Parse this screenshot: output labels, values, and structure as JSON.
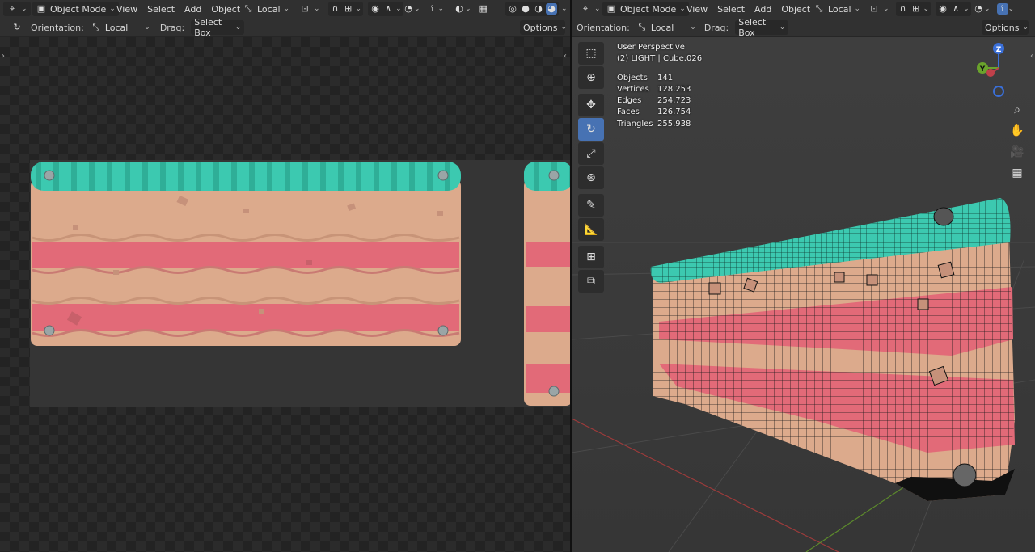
{
  "left": {
    "header": {
      "mode": "Object Mode",
      "menus": [
        "View",
        "Select",
        "Add",
        "Object"
      ],
      "pivot": "Local"
    },
    "toolsettings": {
      "orientation_label": "Orientation:",
      "orientation_value": "Local",
      "drag_label": "Drag:",
      "drag_value": "Select Box",
      "options": "Options"
    }
  },
  "right": {
    "header": {
      "mode": "Object Mode",
      "menus": [
        "View",
        "Select",
        "Add",
        "Object"
      ],
      "pivot": "Local"
    },
    "toolsettings": {
      "orientation_label": "Orientation:",
      "orientation_value": "Local",
      "drag_label": "Drag:",
      "drag_value": "Select Box",
      "options": "Options"
    },
    "overlay": {
      "view_name": "User Perspective",
      "object_info": "(2) LIGHT | Cube.026",
      "stats": [
        {
          "label": "Objects",
          "value": "141"
        },
        {
          "label": "Vertices",
          "value": "128,253"
        },
        {
          "label": "Edges",
          "value": "254,723"
        },
        {
          "label": "Faces",
          "value": "126,754"
        },
        {
          "label": "Triangles",
          "value": "255,938"
        }
      ]
    },
    "gizmo": {
      "z": "Z",
      "y": "Y"
    }
  },
  "colors": {
    "accent": "#4772b3",
    "teal": "#3cc9b0",
    "pink": "#e26a78",
    "peach": "#dcaa8c"
  },
  "icons": {
    "toolbar": [
      "select-box-icon",
      "cursor-icon",
      "move-icon",
      "rotate-icon",
      "scale-icon",
      "transform-icon",
      "annotate-icon",
      "measure-icon",
      "add-cube-icon",
      "extrude-icon"
    ],
    "nav": [
      "zoom-icon",
      "pan-hand-icon",
      "camera-icon",
      "ortho-grid-icon"
    ]
  }
}
